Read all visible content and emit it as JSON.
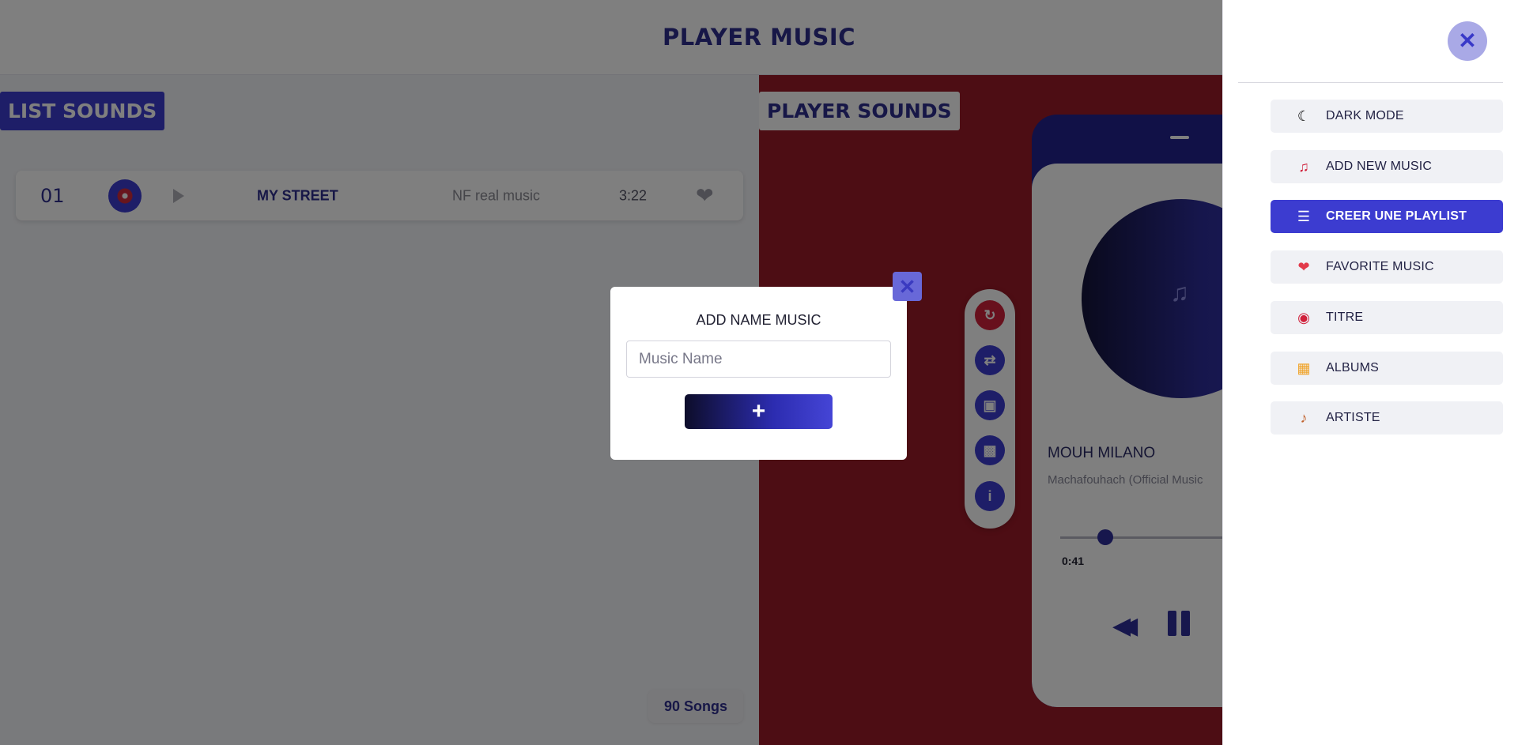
{
  "header": {
    "title": "PLAYER MUSIC"
  },
  "list_panel": {
    "badge": "LIST SOUNDS",
    "songs": [
      {
        "number": "01",
        "title": "MY STREET",
        "artist": "NF real music",
        "duration": "3:22"
      }
    ],
    "count_label": "90 Songs"
  },
  "player_panel": {
    "badge": "PLAYER SOUNDS",
    "now_playing": {
      "title": "MOUH MILANO",
      "subtitle": "Machafouhach (Official Music",
      "current_time": "0:41",
      "progress": 0.22
    },
    "actions": [
      "redo-icon",
      "repeat-icon",
      "shuffle-dice-icon",
      "trash-icon",
      "info-icon"
    ]
  },
  "modal": {
    "title": "ADD NAME MUSIC",
    "input_placeholder": "Music Name",
    "input_value": "",
    "add_label": "+"
  },
  "side_menu": {
    "items": [
      {
        "label": "DARK MODE",
        "icon": "dark-mode-icon",
        "active": false
      },
      {
        "label": "ADD NEW MUSIC",
        "icon": "add-music-icon",
        "active": false
      },
      {
        "label": "CREER UNE PLAYLIST",
        "icon": "playlist-icon",
        "active": true
      },
      {
        "label": "FAVORITE MUSIC",
        "icon": "heart-icon",
        "active": false
      },
      {
        "label": "TITRE",
        "icon": "disc-icon",
        "active": false
      },
      {
        "label": "ALBUMS",
        "icon": "album-icon",
        "active": false
      },
      {
        "label": "ARTISTE",
        "icon": "guitar-icon",
        "active": false
      }
    ]
  },
  "colors": {
    "primary": "#3c3cd0",
    "dark_text": "#2e2e8f",
    "player_bg": "#9b1a28"
  }
}
